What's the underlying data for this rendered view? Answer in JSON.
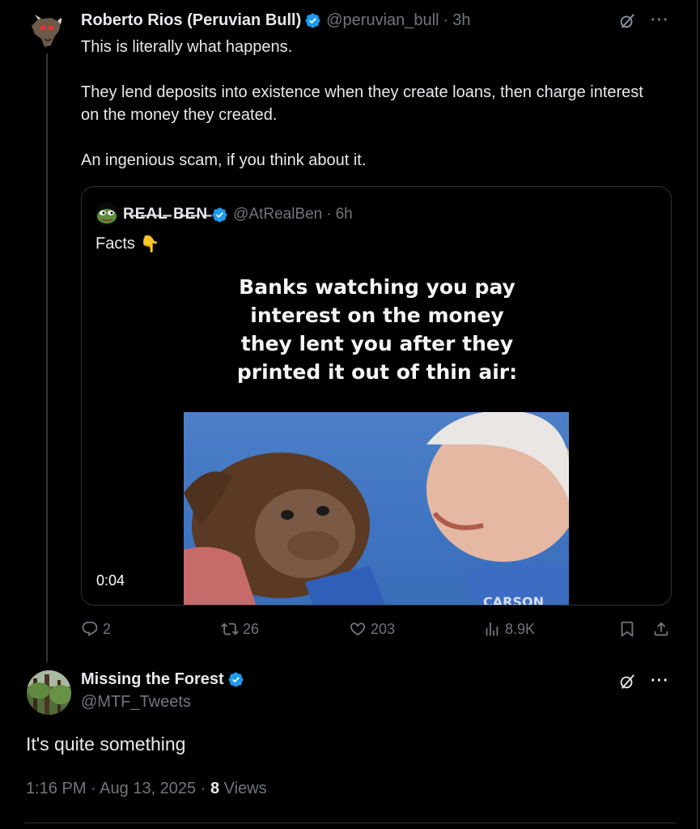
{
  "tweet": {
    "author_name": "Roberto Rios (Peruvian Bull)",
    "handle": "@peruvian_bull",
    "time": "3h",
    "paragraphs": [
      "This is literally what happens.",
      "They lend deposits into existence when they create loans, then charge interest on the money they created.",
      "An ingenious scam, if you think about it."
    ]
  },
  "quote": {
    "author_name": "R̶E̶A̶L̶ B̶E̶N̶",
    "handle": "@AtRealBen",
    "time": "6h",
    "text": "Facts",
    "text_emoji": "👇",
    "meme_caption": "Banks watching you pay interest on the money they lent you after they printed it out of thin air:",
    "video_timestamp": "0:04"
  },
  "actions": {
    "replies": "2",
    "reposts": "26",
    "likes": "203",
    "views": "8.9K"
  },
  "reply": {
    "author_name": "Missing the Forest",
    "handle": "@MTF_Tweets",
    "text": "It's quite something",
    "time": "1:16 PM",
    "date": "Aug 13, 2025",
    "views_count": "8",
    "views_label": "Views"
  },
  "colors": {
    "background": "#000000",
    "text": "#e7e9ea",
    "muted": "#71767b",
    "verified": "#1d9bf0",
    "border": "#2f3336"
  },
  "icons": [
    "grok-icon",
    "more-icon",
    "verified-icon",
    "reply-icon",
    "repost-icon",
    "like-icon",
    "views-icon",
    "bookmark-icon",
    "share-icon"
  ]
}
